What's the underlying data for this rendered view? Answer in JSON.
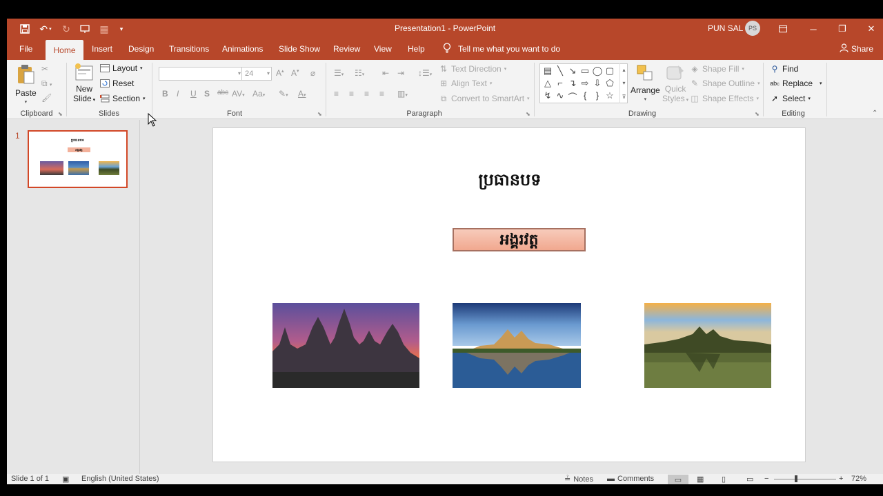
{
  "window": {
    "title": "Presentation1  -  PowerPoint",
    "user_name": "PUN SAL",
    "user_initials": "PS"
  },
  "tabs": [
    "File",
    "Home",
    "Insert",
    "Design",
    "Transitions",
    "Animations",
    "Slide Show",
    "Review",
    "View",
    "Help"
  ],
  "active_tab": "Home",
  "tell_me": "Tell me what you want to do",
  "share": "Share",
  "ribbon": {
    "clipboard": {
      "label": "Clipboard",
      "paste": "Paste"
    },
    "slides": {
      "label": "Slides",
      "new_slide_1": "New",
      "new_slide_2": "Slide",
      "layout": "Layout",
      "reset": "Reset",
      "section": "Section"
    },
    "font": {
      "label": "Font",
      "font_name": "",
      "font_size": "24"
    },
    "paragraph": {
      "label": "Paragraph",
      "text_direction": "Text Direction",
      "align_text": "Align Text",
      "convert_smartart": "Convert to SmartArt"
    },
    "drawing": {
      "label": "Drawing",
      "arrange": "Arrange",
      "quick_styles_1": "Quick",
      "quick_styles_2": "Styles",
      "shape_fill": "Shape Fill",
      "shape_outline": "Shape Outline",
      "shape_effects": "Shape Effects"
    },
    "editing": {
      "label": "Editing",
      "find": "Find",
      "replace": "Replace",
      "select": "Select"
    }
  },
  "thumbnails": [
    {
      "number": "1",
      "title": "ប្រធានបទ",
      "subtitle": "អង្គរវត្ត"
    }
  ],
  "slide": {
    "title": "ប្រធានបទ",
    "box_text": "អង្គរវត្ត"
  },
  "status": {
    "slide_info": "Slide 1 of 1",
    "language": "English (United States)",
    "notes": "Notes",
    "comments": "Comments",
    "zoom": "72%"
  },
  "colors": {
    "accent": "#b7472a",
    "ribbon_bg": "#f3f3f3",
    "workspace": "#e6e6e6"
  }
}
